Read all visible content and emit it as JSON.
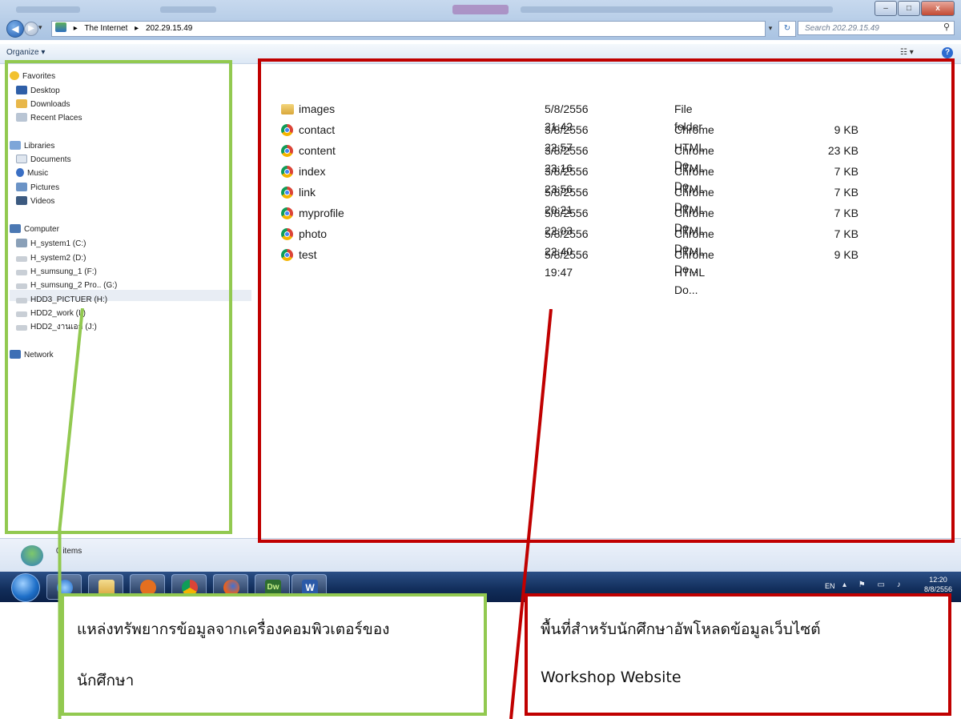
{
  "window": {
    "controls": {
      "minimize": "–",
      "maximize": "□",
      "close": "x"
    }
  },
  "address_bar": {
    "back_icon": "arrow-left",
    "crumbs": [
      "The Internet",
      "202.29.15.49"
    ],
    "search_placeholder": "Search 202.29.15.49"
  },
  "command_bar": {
    "organize_label": "Organize ▾"
  },
  "nav_pane": {
    "favorites": {
      "label": "Favorites",
      "items": [
        "Desktop",
        "Downloads",
        "Recent Places"
      ]
    },
    "libraries": {
      "label": "Libraries",
      "items": [
        "Documents",
        "Music",
        "Pictures",
        "Videos"
      ]
    },
    "computer": {
      "label": "Computer",
      "items": [
        "H_system1 (C:)",
        "H_system2 (D:)",
        "H_sumsung_1 (F:)",
        "H_sumsung_2 Pro.. (G:)",
        "HDD3_PICTUER (H:)",
        "HDD2_work (I:)",
        "HDD2_งานเอก (J:)"
      ]
    },
    "network": {
      "label": "Network"
    }
  },
  "files": [
    {
      "name": "images",
      "date": "5/8/2556 21:42",
      "type": "File folder",
      "size": "",
      "icon": "folder-icon"
    },
    {
      "name": "contact",
      "date": "3/8/2556 22:57",
      "type": "Chrome HTML Do...",
      "size": "9 KB",
      "icon": "chrome-icon"
    },
    {
      "name": "content",
      "date": "3/8/2556 23:16",
      "type": "Chrome HTML Do...",
      "size": "23 KB",
      "icon": "chrome-icon"
    },
    {
      "name": "index",
      "date": "3/8/2556 23:56",
      "type": "Chrome HTML Do...",
      "size": "7 KB",
      "icon": "chrome-icon"
    },
    {
      "name": "link",
      "date": "5/8/2556 20:21",
      "type": "Chrome HTML Do...",
      "size": "7 KB",
      "icon": "chrome-icon"
    },
    {
      "name": "myprofile",
      "date": "5/8/2556 22:03",
      "type": "Chrome HTML Do...",
      "size": "7 KB",
      "icon": "chrome-icon"
    },
    {
      "name": "photo",
      "date": "5/8/2556 22:40",
      "type": "Chrome HTML Do...",
      "size": "7 KB",
      "icon": "chrome-icon"
    },
    {
      "name": "test",
      "date": "5/8/2556 19:47",
      "type": "Chrome HTML Do...",
      "size": "9 KB",
      "icon": "chrome-icon"
    }
  ],
  "status_bar": {
    "text": "0 items"
  },
  "taskbar": {
    "apps": [
      "internet-explorer-icon",
      "file-explorer-icon",
      "media-player-icon",
      "chrome-icon",
      "firefox-icon",
      "dreamweaver-icon",
      "word-icon"
    ],
    "dreamweaver_label": "Dw",
    "word_label": "W",
    "tray_lang": "EN",
    "time": "12:20",
    "date": "8/8/2556"
  },
  "annotations": {
    "left_text_line1": "แหล่งทรัพยากรข้อมูลจากเครื่องคอมพิวเตอร์ของ",
    "left_text_line2": "นักศึกษา",
    "right_text_line1": "พื้นที่สำหรับนักศึกษาอัพโหลดข้อมูลเว็บไซต์",
    "right_text_line2": "Workshop Website",
    "colors": {
      "green": "#92c950",
      "red": "#c00000"
    }
  }
}
